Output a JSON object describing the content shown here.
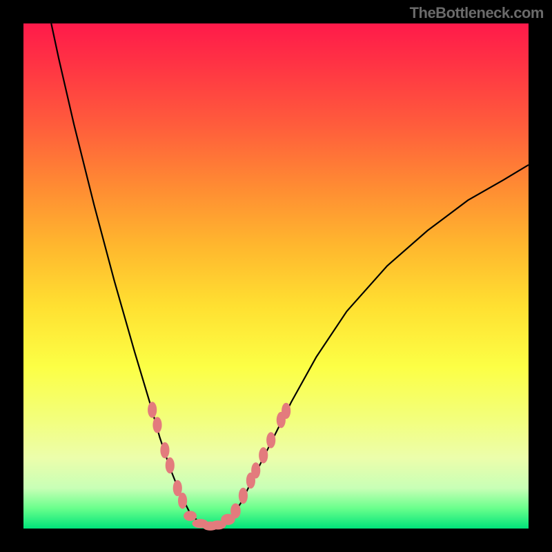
{
  "watermark": "TheBottleneck.com",
  "chart_data": {
    "type": "line",
    "title": "",
    "xlabel": "",
    "ylabel": "",
    "xlim": [
      0,
      100
    ],
    "ylim": [
      0,
      100
    ],
    "curve_points": [
      {
        "x": 5.5,
        "y": 100
      },
      {
        "x": 7,
        "y": 93
      },
      {
        "x": 10,
        "y": 80
      },
      {
        "x": 14,
        "y": 64
      },
      {
        "x": 18,
        "y": 49
      },
      {
        "x": 22,
        "y": 35
      },
      {
        "x": 25,
        "y": 25
      },
      {
        "x": 27,
        "y": 18
      },
      {
        "x": 29,
        "y": 12
      },
      {
        "x": 31,
        "y": 7
      },
      {
        "x": 33,
        "y": 3
      },
      {
        "x": 35,
        "y": 1
      },
      {
        "x": 37,
        "y": 0.3
      },
      {
        "x": 39,
        "y": 0.6
      },
      {
        "x": 41,
        "y": 2
      },
      {
        "x": 43,
        "y": 5
      },
      {
        "x": 46,
        "y": 11
      },
      {
        "x": 49,
        "y": 17
      },
      {
        "x": 53,
        "y": 25
      },
      {
        "x": 58,
        "y": 34
      },
      {
        "x": 64,
        "y": 43
      },
      {
        "x": 72,
        "y": 52
      },
      {
        "x": 80,
        "y": 59
      },
      {
        "x": 88,
        "y": 65
      },
      {
        "x": 95,
        "y": 69
      },
      {
        "x": 100,
        "y": 72
      }
    ],
    "markers": [
      {
        "x": 25.5,
        "y": 23.5,
        "rx": 0.9,
        "ry": 1.6
      },
      {
        "x": 26.5,
        "y": 20.5,
        "rx": 0.9,
        "ry": 1.6
      },
      {
        "x": 28.0,
        "y": 15.5,
        "rx": 0.9,
        "ry": 1.6
      },
      {
        "x": 29.0,
        "y": 12.5,
        "rx": 0.9,
        "ry": 1.6
      },
      {
        "x": 30.5,
        "y": 8.0,
        "rx": 0.9,
        "ry": 1.6
      },
      {
        "x": 31.5,
        "y": 5.5,
        "rx": 0.9,
        "ry": 1.6
      },
      {
        "x": 33.0,
        "y": 2.5,
        "rx": 1.3,
        "ry": 1.0
      },
      {
        "x": 35.0,
        "y": 1.0,
        "rx": 1.6,
        "ry": 0.9
      },
      {
        "x": 37.0,
        "y": 0.5,
        "rx": 1.6,
        "ry": 0.9
      },
      {
        "x": 38.5,
        "y": 0.7,
        "rx": 1.6,
        "ry": 0.9
      },
      {
        "x": 40.5,
        "y": 1.8,
        "rx": 1.4,
        "ry": 1.1
      },
      {
        "x": 42.0,
        "y": 3.5,
        "rx": 1.0,
        "ry": 1.5
      },
      {
        "x": 43.5,
        "y": 6.5,
        "rx": 0.9,
        "ry": 1.6
      },
      {
        "x": 45.0,
        "y": 9.5,
        "rx": 0.9,
        "ry": 1.6
      },
      {
        "x": 46.0,
        "y": 11.5,
        "rx": 0.9,
        "ry": 1.6
      },
      {
        "x": 47.5,
        "y": 14.5,
        "rx": 0.9,
        "ry": 1.6
      },
      {
        "x": 49.0,
        "y": 17.5,
        "rx": 0.9,
        "ry": 1.6
      },
      {
        "x": 51.0,
        "y": 21.5,
        "rx": 0.9,
        "ry": 1.6
      },
      {
        "x": 52.0,
        "y": 23.3,
        "rx": 0.9,
        "ry": 1.6
      }
    ],
    "gradient_colors": {
      "top": "#ff1a4a",
      "mid": "#ffe031",
      "bottom": "#00e47a"
    }
  }
}
